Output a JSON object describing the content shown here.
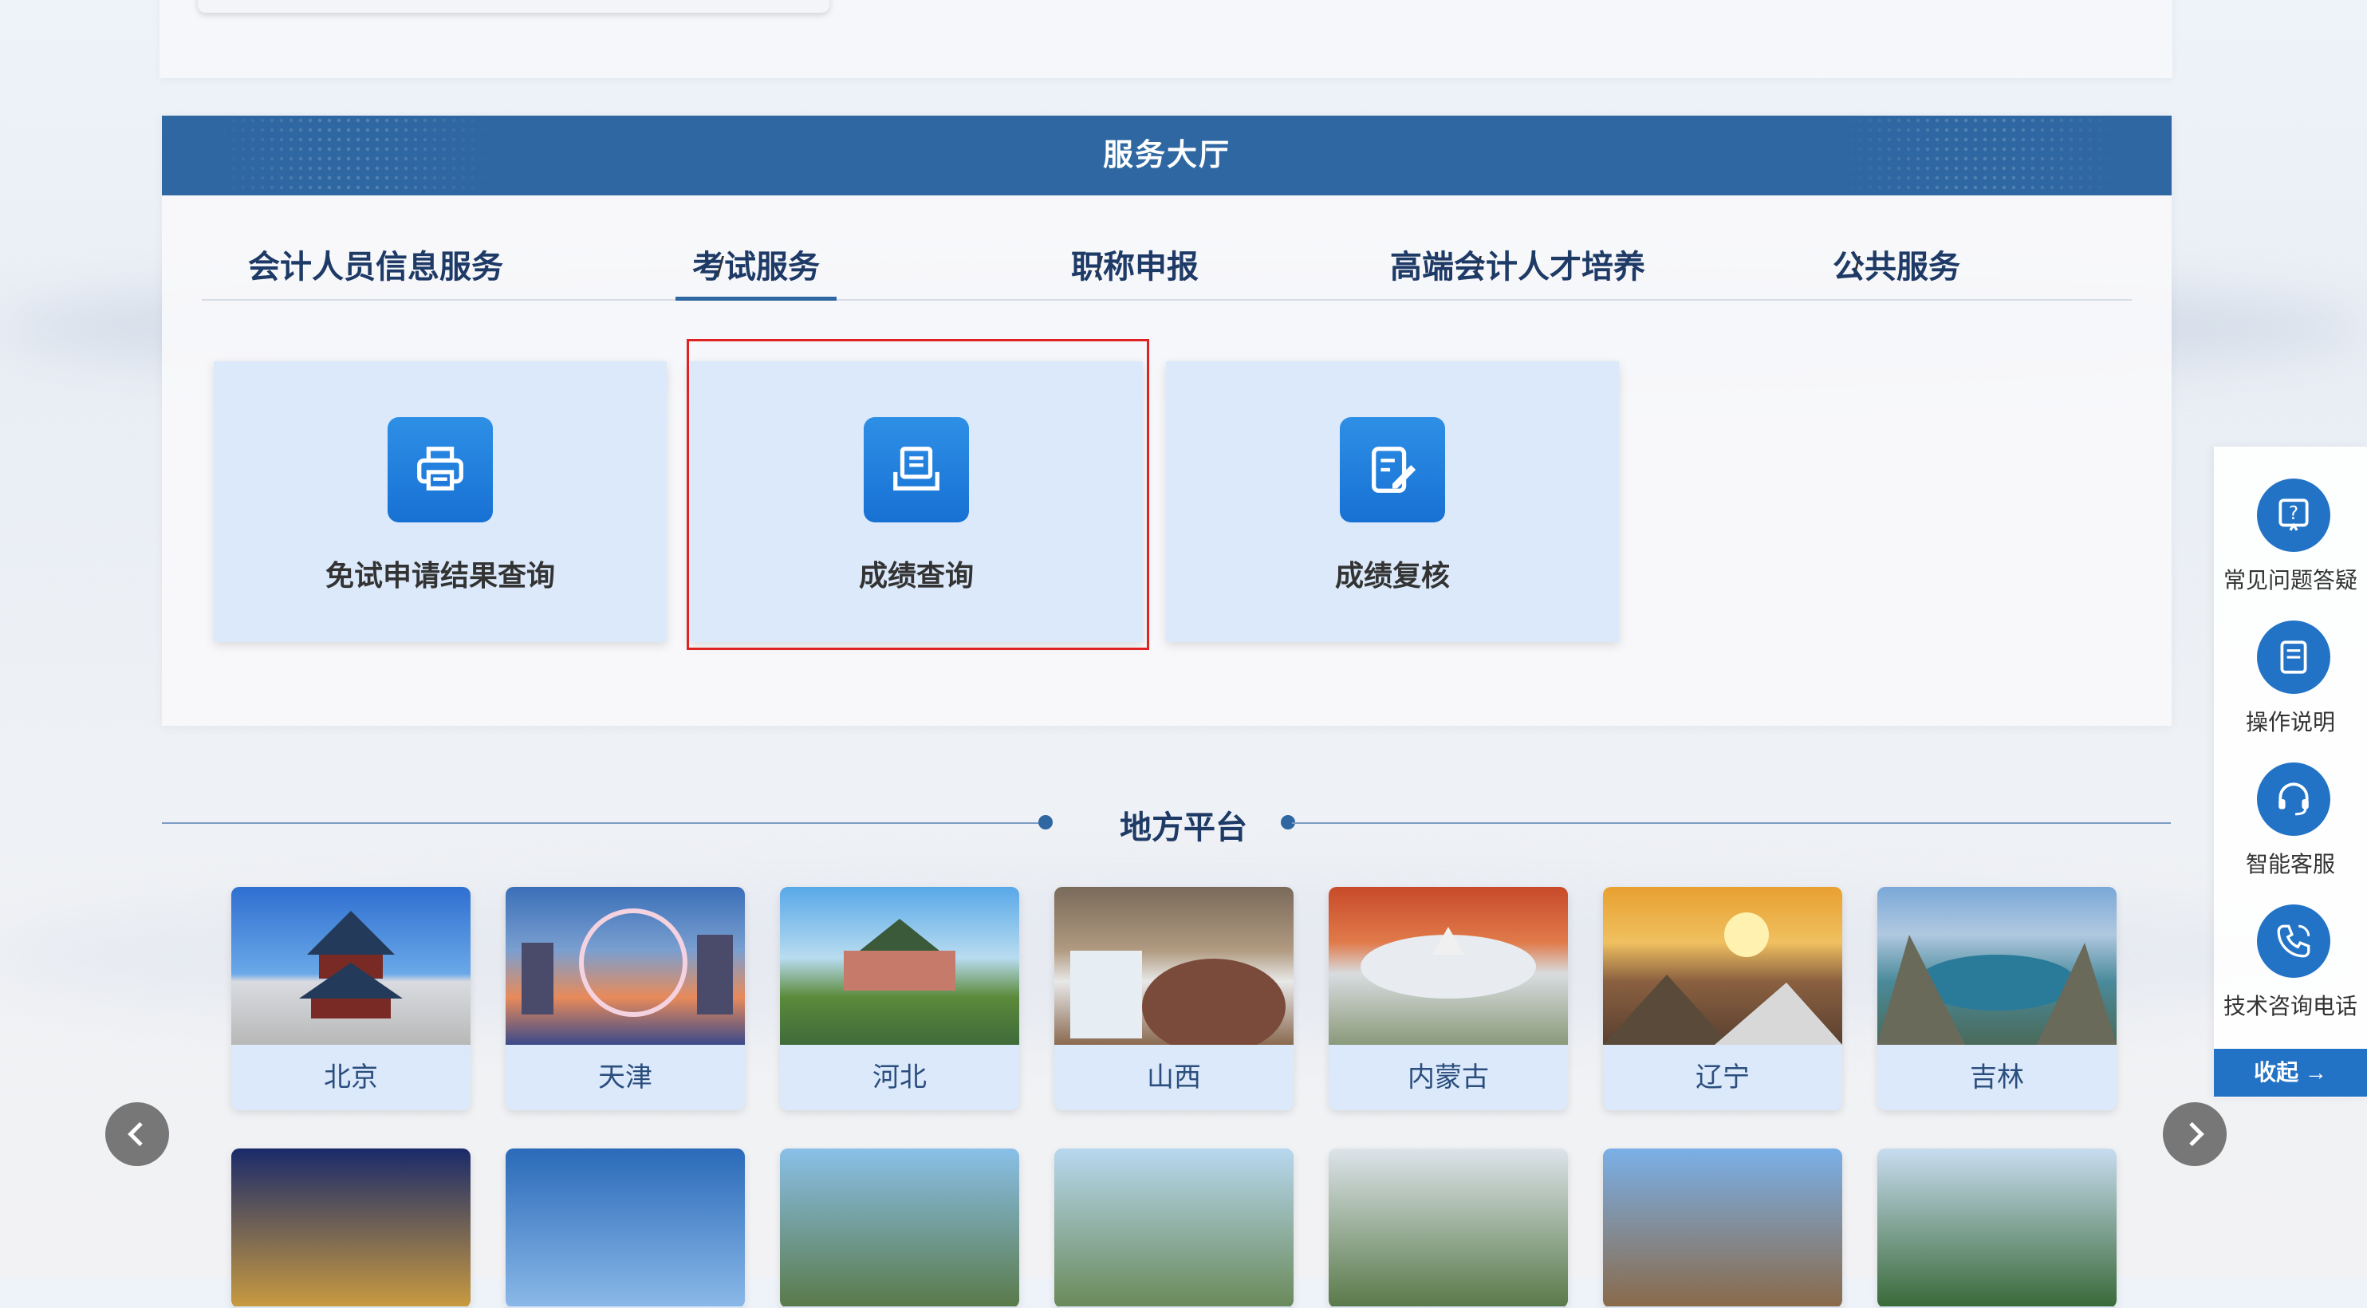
{
  "hall": {
    "title": "服务大厅",
    "tabs": [
      "会计人员信息服务",
      "考试服务",
      "职称申报",
      "高端会计人才培养",
      "公共服务"
    ],
    "separator": "/",
    "active_tab": "考试服务",
    "services": [
      {
        "label": "免试申请结果查询",
        "icon": "printer-icon"
      },
      {
        "label": "成绩查询",
        "icon": "document-list-icon"
      },
      {
        "label": "成绩复核",
        "icon": "edit-document-icon"
      }
    ]
  },
  "local": {
    "title": "地方平台",
    "cities_row1": [
      "北京",
      "天津",
      "河北",
      "山西",
      "内蒙古",
      "辽宁",
      "吉林"
    ]
  },
  "sidebar": {
    "items": [
      {
        "label": "常见问题答疑",
        "icon": "question-icon"
      },
      {
        "label": "操作说明",
        "icon": "manual-icon"
      },
      {
        "label": "智能客服",
        "icon": "headset-icon"
      },
      {
        "label": "技术咨询电话",
        "icon": "phone-icon"
      }
    ],
    "collapse_label": "收起 →"
  },
  "colors": {
    "primary": "#2e67a1",
    "accent": "#2273c6",
    "highlight": "#e02222"
  }
}
